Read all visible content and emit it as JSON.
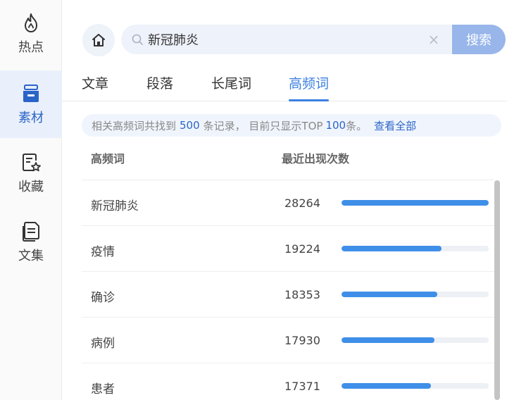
{
  "sidebar": {
    "items": [
      {
        "label": "热点",
        "icon": "fire-icon"
      },
      {
        "label": "素材",
        "icon": "archive-tray-icon",
        "active": true
      },
      {
        "label": "收藏",
        "icon": "document-star-icon"
      },
      {
        "label": "文集",
        "icon": "documents-icon"
      }
    ]
  },
  "search": {
    "value": "新冠肺炎",
    "button_label": "搜索",
    "clear_glyph": "×"
  },
  "tabs": [
    {
      "label": "文章"
    },
    {
      "label": "段落"
    },
    {
      "label": "长尾词"
    },
    {
      "label": "高频词",
      "active": true
    }
  ],
  "banner": {
    "prefix": "相关高频词共找到",
    "total": "500",
    "middle": "条记录， 目前只显示TOP",
    "shown": "100",
    "suffix": "条。",
    "view_all": "查看全部"
  },
  "table": {
    "headers": {
      "word": "高频词",
      "count": "最近出现次数"
    },
    "rows": [
      {
        "word": "新冠肺炎",
        "count": "28264",
        "ratio": 1.0
      },
      {
        "word": "疫情",
        "count": "19224",
        "ratio": 0.68
      },
      {
        "word": "确诊",
        "count": "18353",
        "ratio": 0.65
      },
      {
        "word": "病例",
        "count": "17930",
        "ratio": 0.63
      },
      {
        "word": "患者",
        "count": "17371",
        "ratio": 0.61
      }
    ]
  },
  "colors": {
    "accent": "#3b7fe0",
    "bar": "#3f8fe8",
    "search_button": "#98b6ea"
  }
}
